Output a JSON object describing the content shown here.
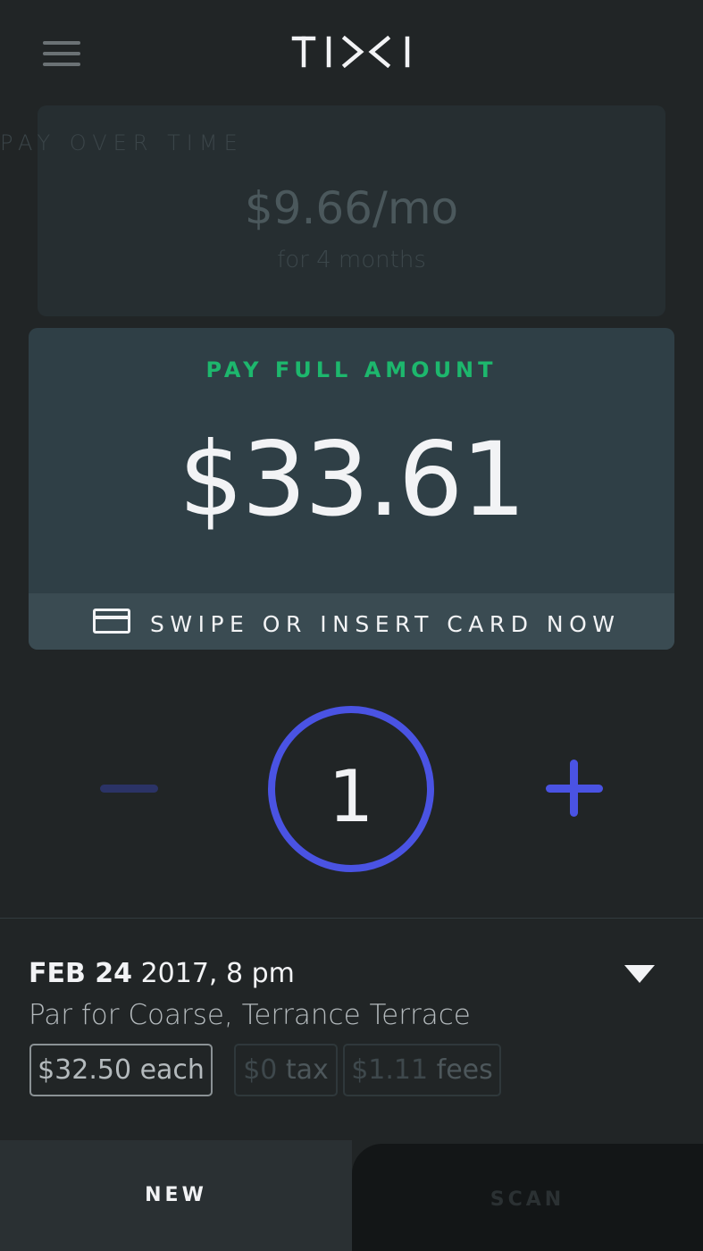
{
  "app": {
    "logo_text": "TIXI"
  },
  "pay_over_time": {
    "label": "PAY OVER TIME",
    "amount": "$9.66/mo",
    "sub": "for 4 months"
  },
  "pay_full": {
    "label": "PAY FULL AMOUNT",
    "amount": "$33.61",
    "swipe_text": "SWIPE OR INSERT CARD NOW"
  },
  "quantity": {
    "value": "1"
  },
  "event": {
    "date_bold": "FEB 24",
    "date_rest": " 2017, 8 pm",
    "venue": "Par for Coarse, Terrance Terrace"
  },
  "pricing": {
    "each": "$32.50 each",
    "tax_amount": "$0",
    "tax_label": " tax",
    "fees_amount": "$1.11",
    "fees_label": " fees"
  },
  "tabs": {
    "new": "NEW",
    "scan": "SCAN"
  },
  "colors": {
    "accent": "#4a53e3",
    "success": "#1db76d",
    "background": "#212526"
  }
}
